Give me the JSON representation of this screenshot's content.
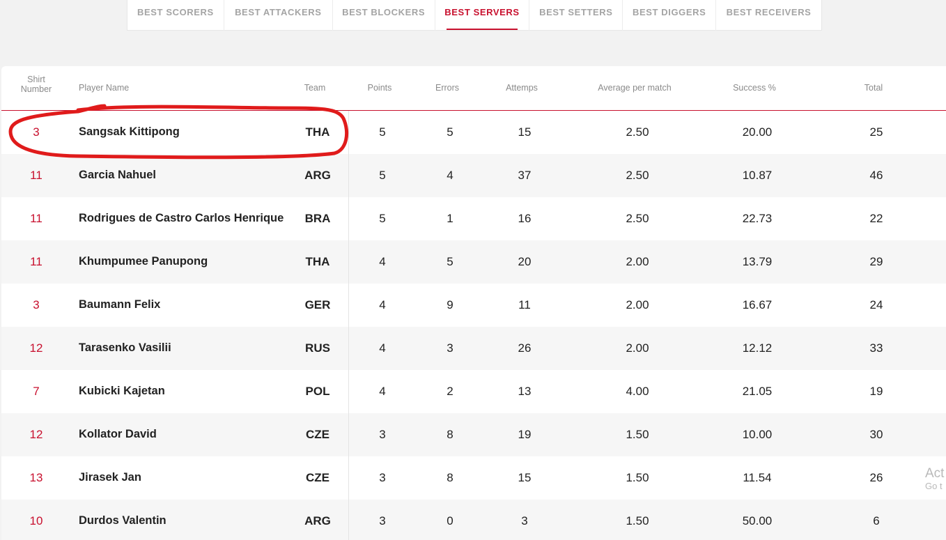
{
  "tabs": [
    {
      "label": "BEST SCORERS",
      "active": false
    },
    {
      "label": "BEST ATTACKERS",
      "active": false
    },
    {
      "label": "BEST BLOCKERS",
      "active": false
    },
    {
      "label": "BEST SERVERS",
      "active": true
    },
    {
      "label": "BEST SETTERS",
      "active": false
    },
    {
      "label": "BEST DIGGERS",
      "active": false
    },
    {
      "label": "BEST RECEIVERS",
      "active": false
    }
  ],
  "columns": {
    "shirt": "Shirt\nNumber",
    "name": "Player Name",
    "team": "Team",
    "points": "Points",
    "errors": "Errors",
    "attempts": "Attemps",
    "average": "Average per match",
    "success": "Success %",
    "total": "Total"
  },
  "rows": [
    {
      "shirt": "3",
      "name": "Sangsak Kittipong",
      "team": "THA",
      "points": "5",
      "errors": "5",
      "attempts": "15",
      "average": "2.50",
      "success": "20.00",
      "total": "25"
    },
    {
      "shirt": "11",
      "name": "Garcia Nahuel",
      "team": "ARG",
      "points": "5",
      "errors": "4",
      "attempts": "37",
      "average": "2.50",
      "success": "10.87",
      "total": "46"
    },
    {
      "shirt": "11",
      "name": "Rodrigues de Castro Carlos Henrique",
      "team": "BRA",
      "points": "5",
      "errors": "1",
      "attempts": "16",
      "average": "2.50",
      "success": "22.73",
      "total": "22"
    },
    {
      "shirt": "11",
      "name": "Khumpumee Panupong",
      "team": "THA",
      "points": "4",
      "errors": "5",
      "attempts": "20",
      "average": "2.00",
      "success": "13.79",
      "total": "29"
    },
    {
      "shirt": "3",
      "name": "Baumann Felix",
      "team": "GER",
      "points": "4",
      "errors": "9",
      "attempts": "11",
      "average": "2.00",
      "success": "16.67",
      "total": "24"
    },
    {
      "shirt": "12",
      "name": "Tarasenko Vasilii",
      "team": "RUS",
      "points": "4",
      "errors": "3",
      "attempts": "26",
      "average": "2.00",
      "success": "12.12",
      "total": "33"
    },
    {
      "shirt": "7",
      "name": "Kubicki Kajetan",
      "team": "POL",
      "points": "4",
      "errors": "2",
      "attempts": "13",
      "average": "4.00",
      "success": "21.05",
      "total": "19"
    },
    {
      "shirt": "12",
      "name": "Kollator David",
      "team": "CZE",
      "points": "3",
      "errors": "8",
      "attempts": "19",
      "average": "1.50",
      "success": "10.00",
      "total": "30"
    },
    {
      "shirt": "13",
      "name": "Jirasek Jan",
      "team": "CZE",
      "points": "3",
      "errors": "8",
      "attempts": "15",
      "average": "1.50",
      "success": "11.54",
      "total": "26"
    },
    {
      "shirt": "10",
      "name": "Durdos Valentin",
      "team": "ARG",
      "points": "3",
      "errors": "0",
      "attempts": "3",
      "average": "1.50",
      "success": "50.00",
      "total": "6"
    }
  ],
  "watermark": {
    "line1": "Act",
    "line2": "Go t"
  },
  "colors": {
    "accent": "#c8102e",
    "annotation": "#e01b1b"
  }
}
